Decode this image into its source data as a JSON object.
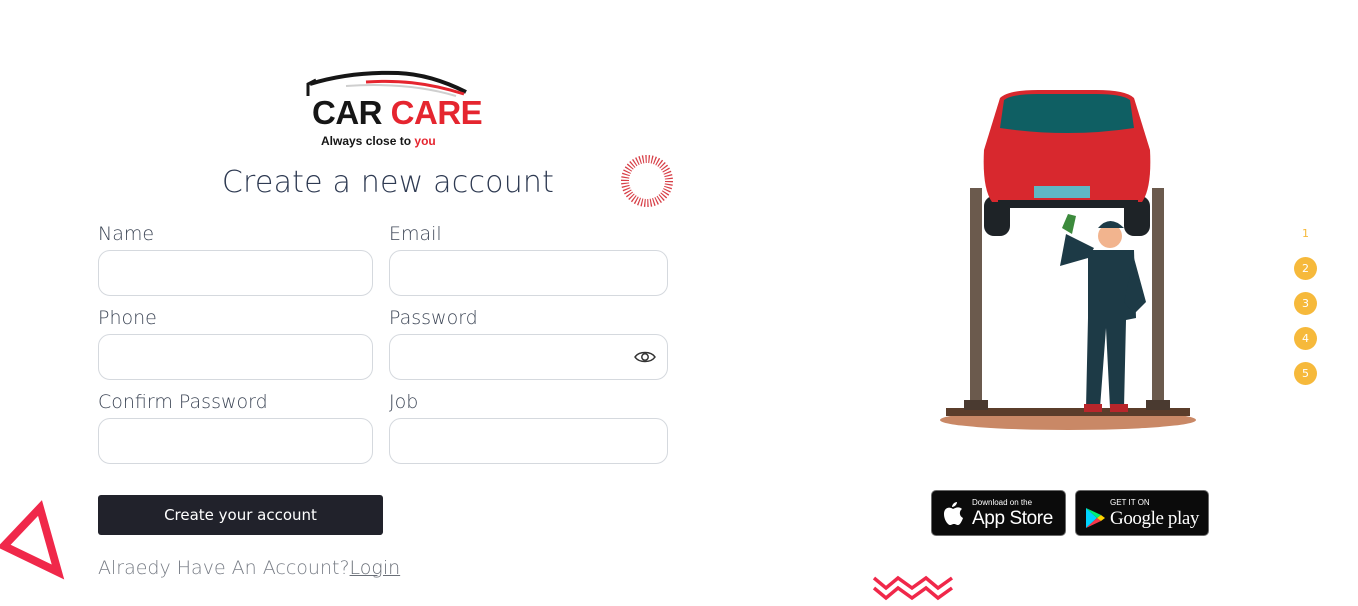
{
  "brand": {
    "name_part1": "CAR",
    "name_part2": "CARE",
    "tagline_main": "Always close to",
    "tagline_accent": "you"
  },
  "form": {
    "title": "Create a new account",
    "fields": {
      "name": {
        "label": "Name",
        "value": ""
      },
      "email": {
        "label": "Email",
        "value": ""
      },
      "phone": {
        "label": "Phone",
        "value": ""
      },
      "password": {
        "label": "Password",
        "value": "",
        "toggle_icon": "eye-icon"
      },
      "confirm_password": {
        "label": "Confirm Password",
        "value": ""
      },
      "job": {
        "label": "Job",
        "value": ""
      }
    },
    "submit_label": "Create your account",
    "login_prompt": "Alraedy Have An Account?",
    "login_link": "Login"
  },
  "stores": {
    "apple_small": "Download on the",
    "apple_big": "App Store",
    "google_small": "GET IT ON",
    "google_big": "Google play"
  },
  "pager": [
    "1",
    "2",
    "3",
    "4",
    "5"
  ],
  "colors": {
    "accent_red": "#e5252f",
    "button_dark": "#21222b",
    "pager_yellow": "#f6b93b",
    "title_text": "#2e3a52"
  }
}
